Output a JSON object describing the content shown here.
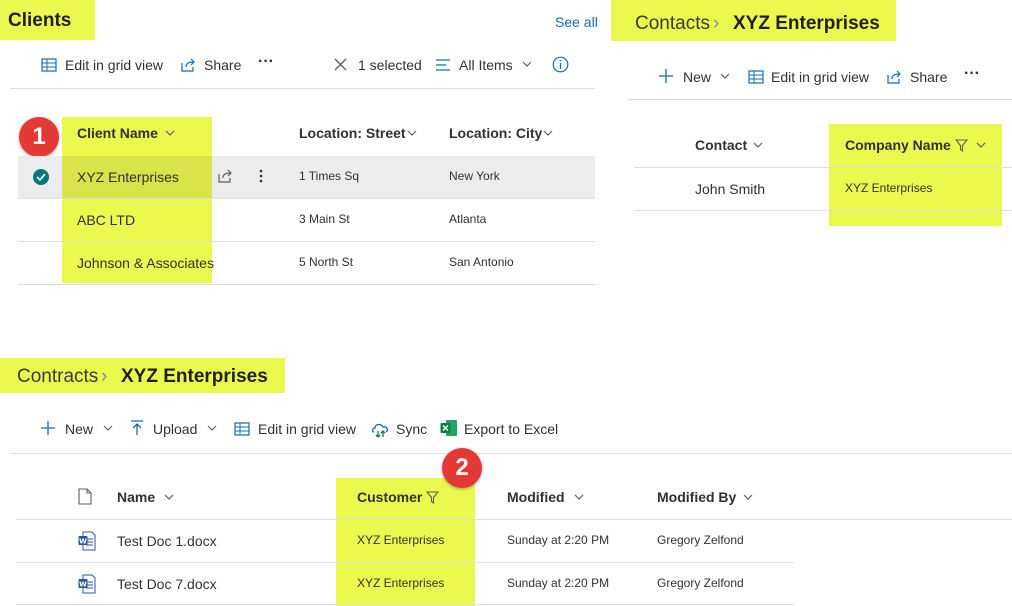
{
  "colors": {
    "highlight": "#ebf94f",
    "badge": "#e53935",
    "accent": "#0f6cbd",
    "check": "#03787c"
  },
  "clients": {
    "title": "Clients",
    "see_all": "See all",
    "toolbar": {
      "edit_grid": "Edit in grid view",
      "share": "Share",
      "selected": "1 selected",
      "view": "All Items"
    },
    "badge": "1",
    "columns": [
      "Client Name",
      "Location: Street",
      "Location: City"
    ],
    "rows": [
      {
        "name": "XYZ Enterprises",
        "street": "1 Times Sq",
        "city": "New York",
        "selected": true
      },
      {
        "name": "ABC LTD",
        "street": "3 Main St",
        "city": "Atlanta",
        "selected": false
      },
      {
        "name": "Johnson & Associates",
        "street": "5 North St",
        "city": "San Antonio",
        "selected": false
      }
    ]
  },
  "contacts": {
    "breadcrumb": [
      "Contacts",
      "XYZ Enterprises"
    ],
    "toolbar": {
      "new": "New",
      "edit_grid": "Edit in grid view",
      "share": "Share"
    },
    "columns": [
      "Contact",
      "Company Name"
    ],
    "rows": [
      {
        "contact": "John Smith",
        "company": "XYZ Enterprises"
      }
    ]
  },
  "contracts": {
    "breadcrumb": [
      "Contracts",
      "XYZ Enterprises"
    ],
    "toolbar": {
      "new": "New",
      "upload": "Upload",
      "edit_grid": "Edit in grid view",
      "sync": "Sync",
      "export": "Export to Excel"
    },
    "badge": "2",
    "columns": [
      "Name",
      "Customer",
      "Modified",
      "Modified By"
    ],
    "rows": [
      {
        "name": "Test Doc 1.docx",
        "customer": "XYZ Enterprises",
        "modified": "Sunday at 2:20 PM",
        "modified_by": "Gregory Zelfond"
      },
      {
        "name": "Test Doc 7.docx",
        "customer": "XYZ Enterprises",
        "modified": "Sunday at 2:20 PM",
        "modified_by": "Gregory Zelfond"
      }
    ]
  }
}
